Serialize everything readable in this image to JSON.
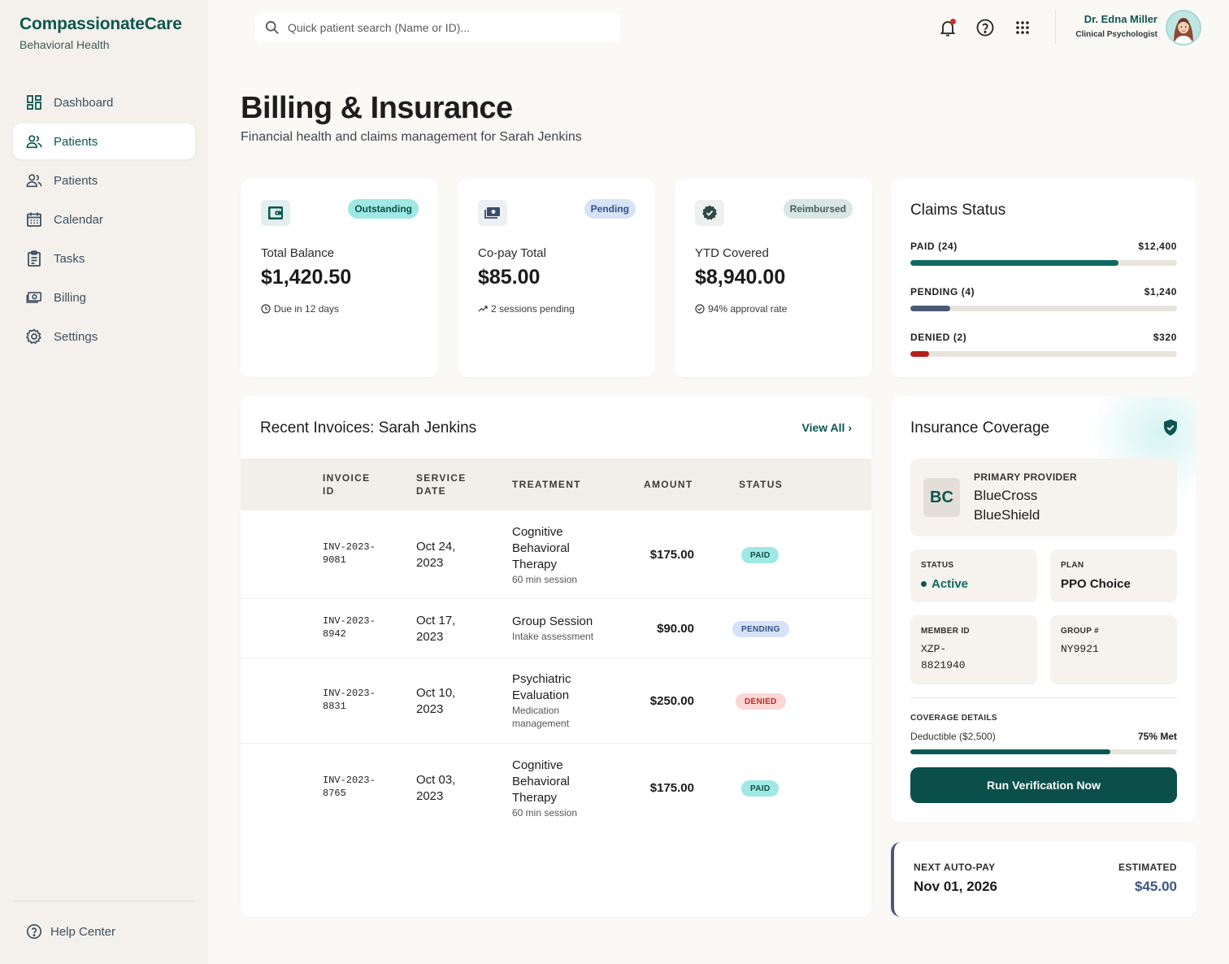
{
  "app": {
    "name": "CompassionateCare",
    "subtitle": "Behavioral Health"
  },
  "sidebar": {
    "items": [
      {
        "label": "Dashboard",
        "icon": "dashboard-icon"
      },
      {
        "label": "Patients",
        "icon": "users-icon",
        "active": true
      },
      {
        "label": "Patients",
        "icon": "users-icon"
      },
      {
        "label": "Calendar",
        "icon": "calendar-icon"
      },
      {
        "label": "Tasks",
        "icon": "clipboard-icon"
      },
      {
        "label": "Billing",
        "icon": "banknote-icon"
      },
      {
        "label": "Settings",
        "icon": "gear-icon"
      }
    ],
    "help_label": "Help Center"
  },
  "search": {
    "placeholder": "Quick patient search (Name or ID)...",
    "value": ""
  },
  "user": {
    "name": "Dr. Edna Miller",
    "role": "Clinical Psychologist"
  },
  "header": {
    "title": "Billing & Insurance",
    "subtitle": "Financial health and claims management for Sarah Jenkins"
  },
  "stats": [
    {
      "label": "Total Balance",
      "value": "$1,420.50",
      "badge": "Outstanding",
      "foot": "Due in 12 days",
      "icon": "wallet-icon"
    },
    {
      "label": "Co-pay Total",
      "value": "$85.00",
      "badge": "Pending",
      "foot": "2 sessions pending",
      "icon": "cash-icon"
    },
    {
      "label": "YTD Covered",
      "value": "$8,940.00",
      "badge": "Reimbursed",
      "foot": "94% approval rate",
      "icon": "verified-badge-icon"
    }
  ],
  "claims": {
    "title": "Claims Status",
    "rows": [
      {
        "label": "PAID (24)",
        "amount": "$12,400",
        "fraction": 0.78,
        "color": "#0d6a62"
      },
      {
        "label": "PENDING (4)",
        "amount": "$1,240",
        "fraction": 0.15,
        "color": "#4b5a74"
      },
      {
        "label": "DENIED (2)",
        "amount": "$320",
        "fraction": 0.07,
        "color": "#b71c1c"
      }
    ]
  },
  "invoices": {
    "title": "Recent Invoices: Sarah Jenkins",
    "view_all": "View All",
    "columns": [
      "INVOICE ID",
      "SERVICE DATE",
      "TREATMENT",
      "AMOUNT",
      "STATUS"
    ],
    "rows": [
      {
        "id": "INV-2023-9081",
        "date": "Oct 24, 2023",
        "treatment": "Cognitive Behavioral Therapy",
        "detail": "60 min session",
        "amount": "$175.00",
        "status": "PAID"
      },
      {
        "id": "INV-2023-8942",
        "date": "Oct 17, 2023",
        "treatment": "Group Session",
        "detail": "Intake assessment",
        "amount": "$90.00",
        "status": "PENDING"
      },
      {
        "id": "INV-2023-8831",
        "date": "Oct 10, 2023",
        "treatment": "Psychiatric Evaluation",
        "detail": "Medication management",
        "amount": "$250.00",
        "status": "DENIED"
      },
      {
        "id": "INV-2023-8765",
        "date": "Oct 03, 2023",
        "treatment": "Cognitive Behavioral Therapy",
        "detail": "60 min session",
        "amount": "$175.00",
        "status": "PAID"
      }
    ]
  },
  "insurance": {
    "title": "Insurance Coverage",
    "provider_label": "PRIMARY PROVIDER",
    "provider_logo": "BC",
    "provider_name": "BlueCross BlueShield",
    "status_label": "STATUS",
    "status_value": "Active",
    "plan_label": "PLAN",
    "plan_value": "PPO Choice",
    "member_label": "MEMBER ID",
    "member_value": "XZP-8821940",
    "group_label": "GROUP #",
    "group_value": "NY9921",
    "coverage_label": "COVERAGE DETAILS",
    "deductible_label": "Deductible ($2,500)",
    "deductible_met": "75% Met",
    "deductible_fraction": 0.75,
    "button_label": "Run Verification Now"
  },
  "autopay": {
    "label": "NEXT AUTO-PAY",
    "date": "Nov 01, 2026",
    "estimated_label": "ESTIMATED",
    "estimated_value": "$45.00"
  },
  "colors": {
    "accent": "#0d5750",
    "paid": "#9fe8e3",
    "pending": "#d6e3f7",
    "denied": "#fbd6d6"
  }
}
